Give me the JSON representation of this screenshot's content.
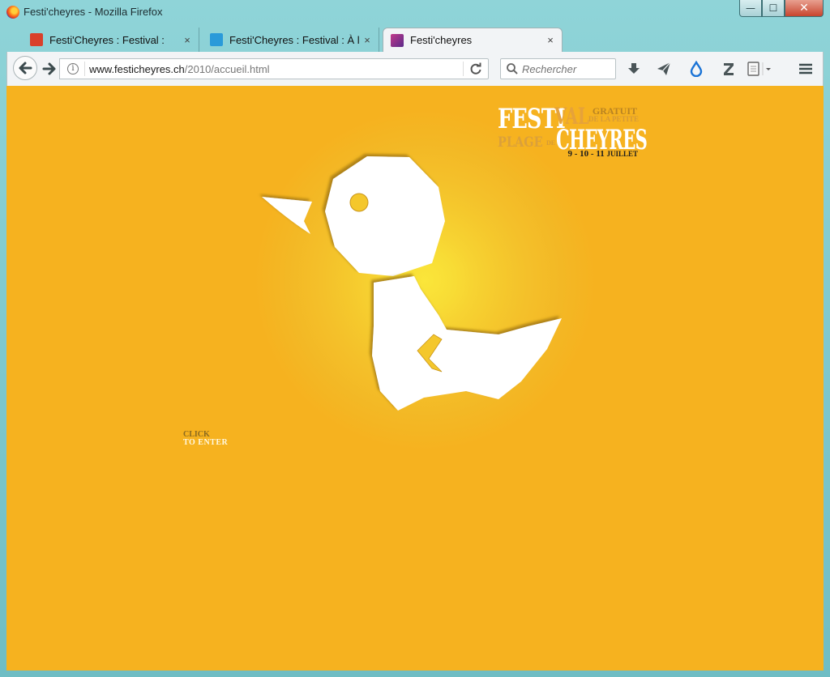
{
  "window": {
    "title": "Festi'cheyres - Mozilla Firefox",
    "controls": {
      "minimize": "—",
      "maximize": "☐",
      "close": "✕"
    }
  },
  "tabs": [
    {
      "label": "Festi'Cheyres : Festival :",
      "close": "×",
      "favicon_color": "#d9402a"
    },
    {
      "label": "Festi'Cheyres : Festival : À l'...",
      "close": "×",
      "favicon_color": "#2a9ad9"
    },
    {
      "label": "Festi'cheyres",
      "close": "×",
      "favicon_color": "#c23a8a",
      "active": true
    }
  ],
  "new_tab": "+",
  "navbar": {
    "url_host": "www.festicheyres.ch",
    "url_path": "/2010/accueil.html",
    "info_icon": "i",
    "search_placeholder": "Rechercher"
  },
  "toolbar_icons": [
    "download-icon",
    "send-icon",
    "drop-icon",
    "zotero-icon",
    "reader-icon",
    "menu-icon"
  ],
  "page": {
    "background": "#f6b21f",
    "logo": {
      "festi": "FESTI",
      "val": "VAL",
      "gratuit": "GRATUIT",
      "de_la_petite": "DE LA PETITE",
      "plage": "PLAGE",
      "de": "DE",
      "cheyres": "CHEYRES",
      "dates": "9 - 10 - 11",
      "month": "JUILLET"
    },
    "click_line1": "CLICK",
    "click_line2": "TO ENTER",
    "mascot": "duck-illustration"
  }
}
